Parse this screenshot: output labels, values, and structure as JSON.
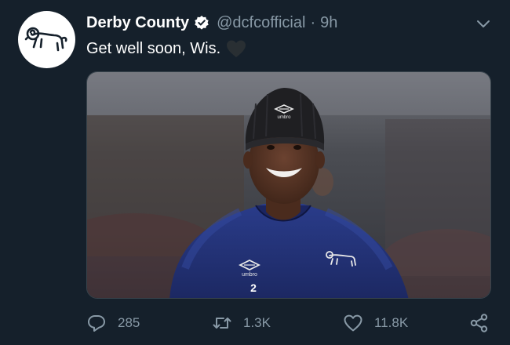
{
  "tweet": {
    "author_name": "Derby County",
    "handle": "@dcfcofficial",
    "separator": "·",
    "time": "9h",
    "text": "Get well soon, Wis.",
    "avatar_icon": "derby-ram-logo",
    "verified_icon": "verified-badge-icon",
    "emoji_icon": "black-heart-emoji",
    "media": {
      "description_icon": "player-photo",
      "kit_number": "2",
      "hat_brand": "umbro",
      "shirt_brand": "umbro"
    }
  },
  "actions": {
    "reply_count": "285",
    "retweet_count": "1.3K",
    "like_count": "11.8K"
  },
  "colors": {
    "background": "#15202b",
    "secondary_text": "#8899a6",
    "primary_text": "#ffffff"
  }
}
